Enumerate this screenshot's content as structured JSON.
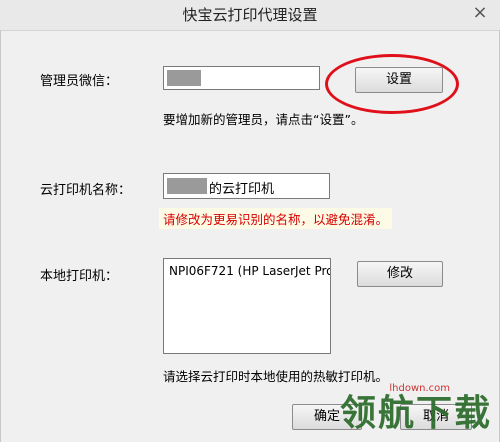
{
  "window": {
    "title": "快宝云打印代理设置",
    "close_glyph": "×"
  },
  "admin": {
    "label": "管理员微信：",
    "set_button": "设置",
    "hint": "要增加新的管理员，请点击“设置”。"
  },
  "cloud_printer": {
    "label": "云打印机名称：",
    "value_suffix": "的云打印机",
    "warning": "请修改为更易识别的名称，以避免混淆。"
  },
  "local_printer": {
    "label": "本地打印机：",
    "selected": "NPI06F721 (HP LaserJet Pro",
    "modify_button": "修改",
    "hint": "请选择云打印时本地使用的热敏打印机。"
  },
  "footer": {
    "ok_button": "确定",
    "cancel_button": "取消"
  },
  "watermark": {
    "text": "领航下载",
    "url": "lhdown.com"
  }
}
